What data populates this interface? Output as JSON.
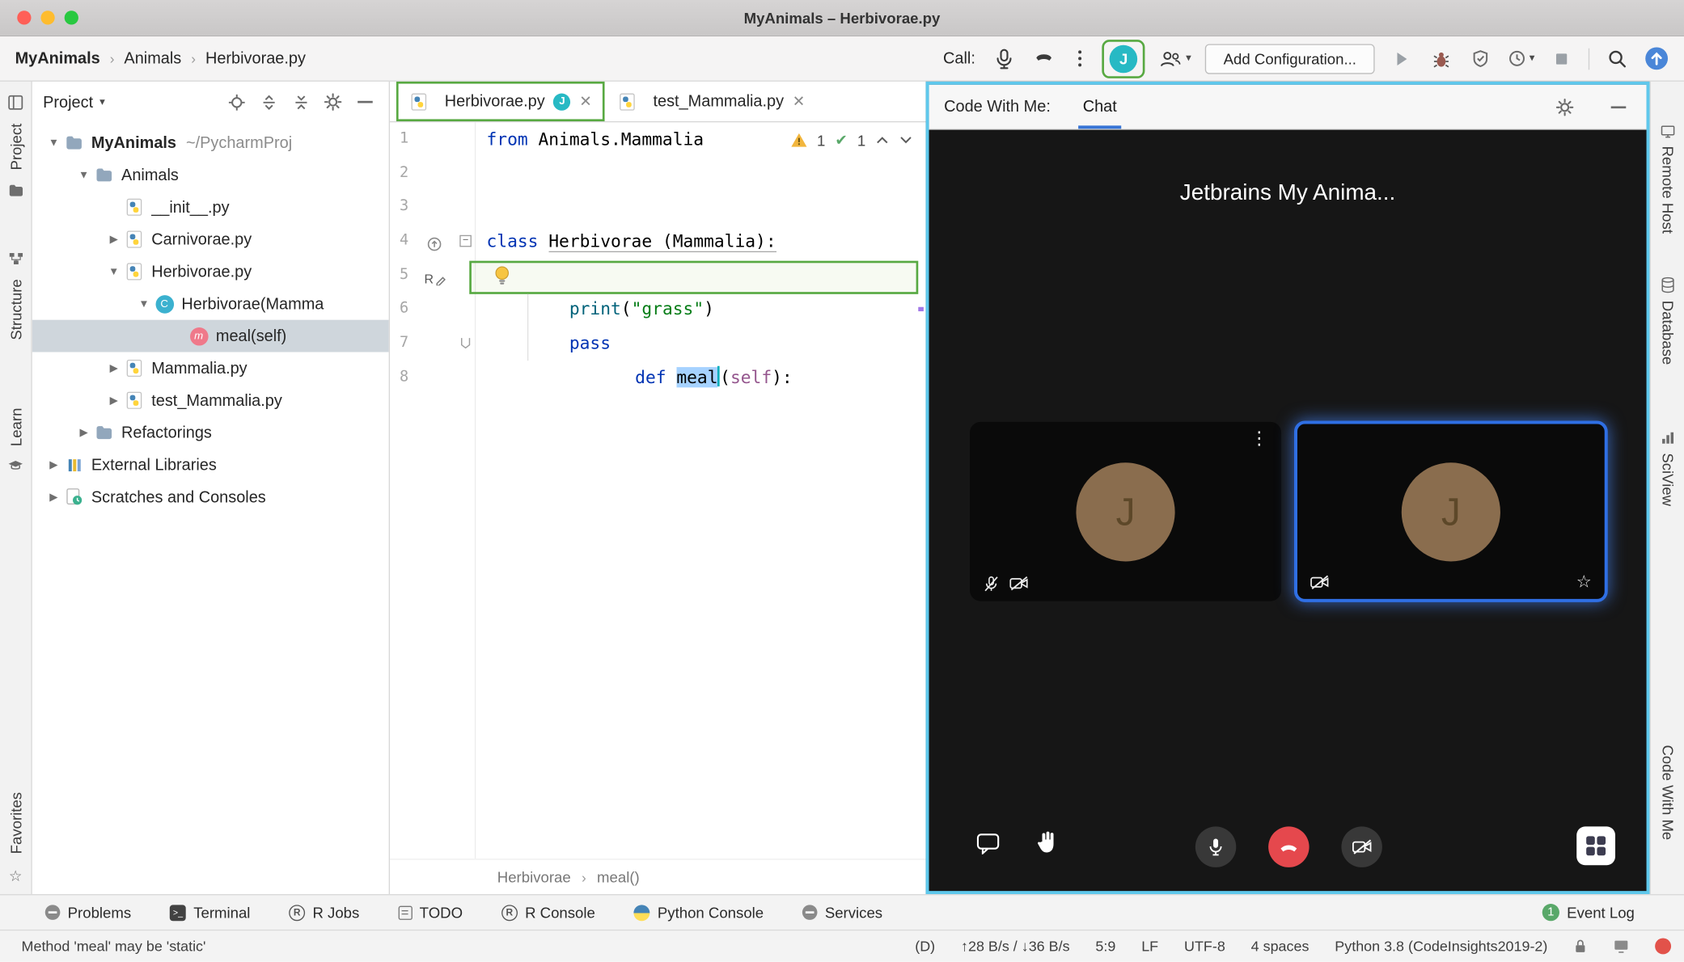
{
  "colors": {
    "accent_green": "#58a942",
    "panel_highlight_cyan": "#5fc8ec",
    "tab_underline_blue": "#3875d6",
    "avatar_teal": "#27b9c4",
    "video_avatar_brown": "#8a6d4e",
    "hangup_red": "#e5484d",
    "event_log_green": "#59a869",
    "selection_blue": "#a6d2ff"
  },
  "icons": {
    "class_glyph": "C",
    "method_glyph": "m",
    "r_glyph": "R",
    "remote_user_glyph": "R"
  },
  "titlebar": {
    "title": "MyAnimals – Herbivorae.py"
  },
  "toolbar": {
    "breadcrumbs": [
      {
        "label": "MyAnimals"
      },
      {
        "label": "Animals"
      },
      {
        "label": "Herbivorae.py"
      }
    ],
    "call_label": "Call:",
    "avatar_initial": "J",
    "add_configuration": "Add Configuration..."
  },
  "left_stripe": {
    "items": [
      {
        "label": "Project"
      },
      {
        "label": "Structure"
      },
      {
        "label": "Learn"
      }
    ],
    "bottom_items": [
      {
        "label": "Favorites"
      }
    ]
  },
  "project": {
    "header_title": "Project",
    "tree": [
      {
        "label": "MyAnimals",
        "suffix": "~/PycharmProj"
      },
      {
        "label": "Animals"
      },
      {
        "label": "__init__.py"
      },
      {
        "label": "Carnivorae.py"
      },
      {
        "label": "Herbivorae.py"
      },
      {
        "label": "Herbivorae(Mamma"
      },
      {
        "label": "meal(self)"
      },
      {
        "label": "Mammalia.py"
      },
      {
        "label": "test_Mammalia.py"
      },
      {
        "label": "Refactorings"
      },
      {
        "label": "External Libraries"
      },
      {
        "label": "Scratches and Consoles"
      }
    ]
  },
  "editor": {
    "tabs": [
      {
        "label": "Herbivorae.py",
        "badge": "J"
      },
      {
        "label": "test_Mammalia.py"
      }
    ],
    "inspections": {
      "warnings": "1",
      "passed": "1"
    },
    "line_numbers": [
      "1",
      "2",
      "3",
      "4",
      "5",
      "6",
      "7",
      "8"
    ],
    "code": {
      "l1": {
        "kw": "from",
        "rest": " Animals.Mammalia"
      },
      "l4": {
        "kw": "class ",
        "name": "Herbivorae (Mammalia):"
      },
      "l5": {
        "kw": "def ",
        "name": "meal",
        "open": "(",
        "self": "self",
        "close": "):"
      },
      "l6": {
        "indent": "        ",
        "fn": "print",
        "open": "(",
        "str": "\"grass\"",
        "close": ")"
      },
      "l7": {
        "indent": "        ",
        "kw": "pass"
      }
    },
    "breadcrumbs": [
      {
        "label": "Herbivorae"
      },
      {
        "label": "meal()"
      }
    ]
  },
  "cwm": {
    "header": {
      "title": "Code With Me:",
      "tab": "Chat"
    },
    "call": {
      "title": "Jetbrains My Anima...",
      "tiles": [
        {
          "initial": "J"
        },
        {
          "initial": "J"
        }
      ]
    }
  },
  "right_stripe": {
    "items": [
      {
        "label": "Remote Host"
      },
      {
        "label": "Database"
      },
      {
        "label": "SciView"
      }
    ],
    "bottom_items": [
      {
        "label": "Code With Me"
      }
    ]
  },
  "bottom_bar": {
    "items": [
      {
        "label": "Problems"
      },
      {
        "label": "Terminal"
      },
      {
        "label": "R Jobs"
      },
      {
        "label": "TODO"
      },
      {
        "label": "R Console"
      },
      {
        "label": "Python Console"
      },
      {
        "label": "Services"
      }
    ],
    "event_log": {
      "badge": "1",
      "label": "Event Log"
    }
  },
  "status_bar": {
    "message": "Method 'meal' may be 'static'",
    "items": [
      {
        "label": "(D)"
      },
      {
        "label": "↑28 B/s / ↓36 B/s"
      },
      {
        "label": "5:9"
      },
      {
        "label": "LF"
      },
      {
        "label": "UTF-8"
      },
      {
        "label": "4 spaces"
      },
      {
        "label": "Python 3.8 (CodeInsights2019-2)"
      }
    ]
  }
}
